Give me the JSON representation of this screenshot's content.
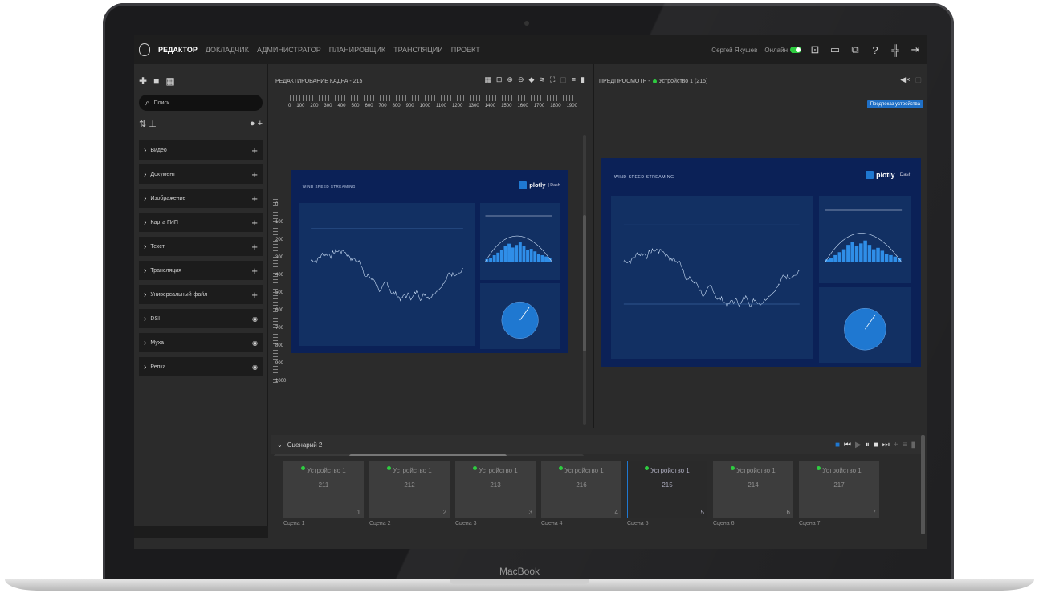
{
  "laptop": {
    "brand": "MacBook"
  },
  "topbar": {
    "nav": [
      "РЕДАКТОР",
      "ДОКЛАДЧИК",
      "АДМИНИСТРАТОР",
      "ПЛАНИРОВЩИК",
      "ТРАНСЛЯЦИИ",
      "ПРОЕКТ"
    ],
    "active": "РЕДАКТОР",
    "user": "Сергей Якушев",
    "online_label": "Онлайн",
    "icons": [
      "presentation-icon",
      "monitor-icon",
      "screen-share-icon",
      "help-icon",
      "collapse-icon",
      "logout-icon"
    ]
  },
  "sidebar": {
    "search_placeholder": "Поиск...",
    "items": [
      {
        "label": "Видео",
        "action": "plus"
      },
      {
        "label": "Документ",
        "action": "plus"
      },
      {
        "label": "Изображение",
        "action": "plus"
      },
      {
        "label": "Карта ГИП",
        "action": "plus"
      },
      {
        "label": "Текст",
        "action": "plus"
      },
      {
        "label": "Трансляция",
        "action": "plus"
      },
      {
        "label": "Универсальный файл",
        "action": "plus"
      },
      {
        "label": "DSI",
        "action": "eye"
      },
      {
        "label": "Муха",
        "action": "eye"
      },
      {
        "label": "Репка",
        "action": "eye"
      }
    ]
  },
  "editor": {
    "title": "РЕДАКТИРОВАНИЕ КАДРА - 215",
    "ruler_x": [
      "0",
      "100",
      "200",
      "300",
      "400",
      "500",
      "600",
      "700",
      "800",
      "900",
      "1000",
      "1100",
      "1200",
      "1300",
      "1400",
      "1500",
      "1600",
      "1700",
      "1800",
      "1900"
    ],
    "ruler_y": [
      "0",
      "100",
      "200",
      "300",
      "400",
      "500",
      "600",
      "700",
      "800",
      "900",
      "1000"
    ]
  },
  "preview": {
    "title_prefix": "ПРЕДПРОСМОТР -",
    "device": "Устройство 1 (215)",
    "button": "Предпоказ устройства"
  },
  "dashboard": {
    "title": "WIND SPEED STREAMING",
    "brand": "plotly",
    "brand_suffix": "Dash"
  },
  "scenario": {
    "title": "Сценарий 2",
    "scenes": [
      {
        "device": "Устройство 1",
        "id": "211",
        "index": "1",
        "name": "Сцена 1",
        "selected": false
      },
      {
        "device": "Устройство 1",
        "id": "212",
        "index": "2",
        "name": "Сцена 2",
        "selected": false
      },
      {
        "device": "Устройство 1",
        "id": "213",
        "index": "3",
        "name": "Сцена 3",
        "selected": false
      },
      {
        "device": "Устройство 1",
        "id": "216",
        "index": "4",
        "name": "Сцена 4",
        "selected": false
      },
      {
        "device": "Устройство 1",
        "id": "215",
        "index": "5",
        "name": "Сцена 5",
        "selected": true
      },
      {
        "device": "Устройство 1",
        "id": "214",
        "index": "6",
        "name": "Сцена 6",
        "selected": false
      },
      {
        "device": "Устройство 1",
        "id": "217",
        "index": "7",
        "name": "Сцена 7",
        "selected": false
      }
    ]
  },
  "colors": {
    "accent": "#1f78d1",
    "online": "#2ecc40",
    "dash_bg": "#0b2157"
  }
}
